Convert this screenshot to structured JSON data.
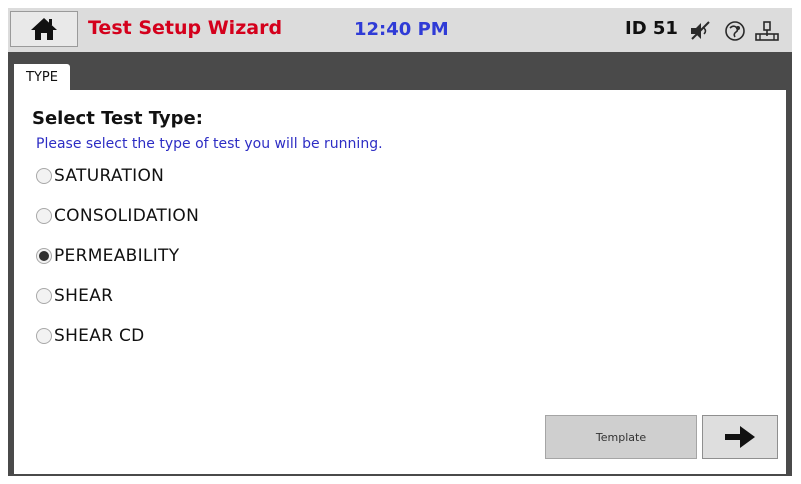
{
  "header": {
    "title": "Test Setup Wizard",
    "time": "12:40 PM",
    "device_id": "ID 51",
    "icons": [
      "home-icon",
      "mute-icon",
      "network-icon",
      "usb-icon"
    ],
    "title_color": "#d4001c",
    "time_color": "#2f3bd6"
  },
  "tab": {
    "label": "TYPE"
  },
  "main": {
    "heading": "Select Test Type:",
    "subtitle": "Please select the type of test you will be running.",
    "options": [
      {
        "label": "SATURATION",
        "selected": false
      },
      {
        "label": "CONSOLIDATION",
        "selected": false
      },
      {
        "label": "PERMEABILITY",
        "selected": true
      },
      {
        "label": "SHEAR",
        "selected": false
      },
      {
        "label": "SHEAR CD",
        "selected": false
      }
    ]
  },
  "footer": {
    "template_label": "Template",
    "next_icon": "arrow-right-icon"
  }
}
